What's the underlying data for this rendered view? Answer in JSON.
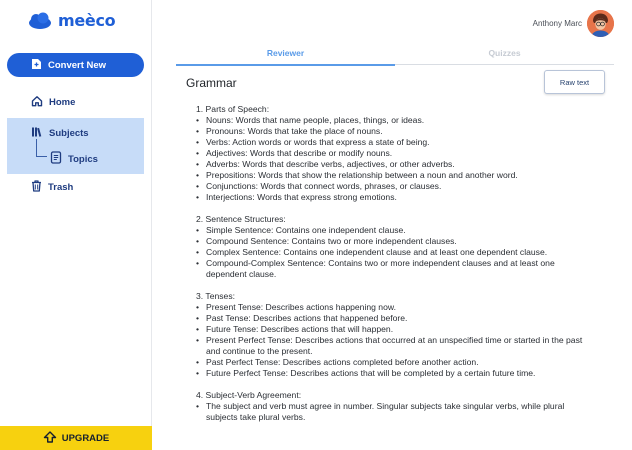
{
  "app": {
    "logo_text": "meèco"
  },
  "sidebar": {
    "convert_label": "Convert New",
    "home_label": "Home",
    "subjects_label": "Subjects",
    "topics_label": "Topics",
    "trash_label": "Trash",
    "upgrade_label": "UPGRADE"
  },
  "header": {
    "user_name": "Anthony Marc"
  },
  "tabs": [
    {
      "label": "Reviewer",
      "active": true
    },
    {
      "label": "Quizzes",
      "active": false
    }
  ],
  "main": {
    "title": "Grammar",
    "raw_text_label": "Raw text",
    "sections": [
      {
        "heading": "1. Parts of Speech:",
        "items": [
          "Nouns: Words that name people, places, things, or ideas.",
          "Pronouns: Words that take the place of nouns.",
          "Verbs: Action words or words that express a state of being.",
          "Adjectives: Words that describe or modify nouns.",
          "Adverbs: Words that describe verbs, adjectives, or other adverbs.",
          "Prepositions: Words that show the relationship between a noun and another word.",
          "Conjunctions: Words that connect words, phrases, or clauses.",
          "Interjections: Words that express strong emotions."
        ]
      },
      {
        "heading": "2. Sentence Structures:",
        "items": [
          "Simple Sentence: Contains one independent clause.",
          "Compound Sentence: Contains two or more independent clauses.",
          "Complex Sentence: Contains one independent clause and at least one dependent clause.",
          "Compound-Complex Sentence: Contains two or more independent clauses and at least one dependent clause."
        ]
      },
      {
        "heading": "3. Tenses:",
        "items": [
          "Present Tense: Describes actions happening now.",
          "Past Tense: Describes actions that happened before.",
          "Future Tense: Describes actions that will happen.",
          "Present Perfect Tense: Describes actions that occurred at an unspecified time or started in the past and continue to the present.",
          "Past Perfect Tense: Describes actions completed before another action.",
          "Future Perfect Tense: Describes actions that will be completed by a certain future time."
        ]
      },
      {
        "heading": "4. Subject-Verb Agreement:",
        "items": [
          "The subject and verb must agree in number. Singular subjects take singular verbs, while plural subjects take plural verbs."
        ]
      }
    ]
  },
  "colors": {
    "brand": "#1f5fd6",
    "active_tab": "#5a9be8",
    "selected_nav": "#c7dcf8",
    "upgrade": "#f7d10f"
  },
  "icons": {
    "convert": "add-document-icon",
    "home": "home-icon",
    "subjects": "books-icon",
    "topics": "document-icon",
    "trash": "trash-icon",
    "upgrade": "arrow-up-icon"
  }
}
